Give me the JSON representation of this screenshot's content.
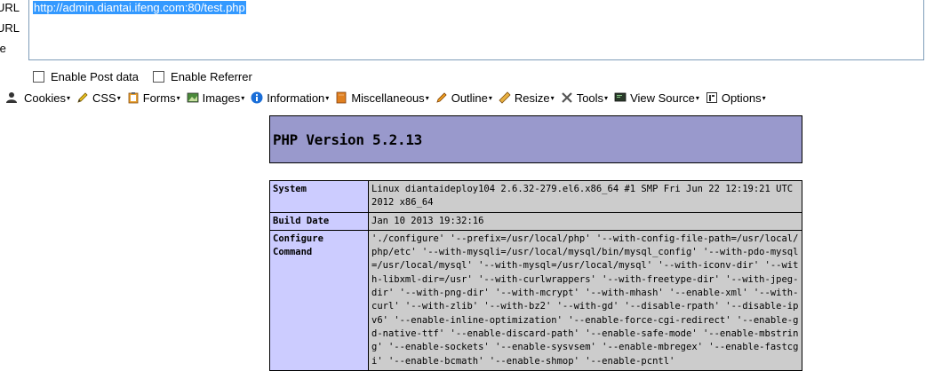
{
  "side_labels": [
    "URL",
    "URL",
    "te"
  ],
  "url": "http://admin.diantai.ifeng.com:80/test.php",
  "options": [
    {
      "label": "Enable Post data",
      "checked": false
    },
    {
      "label": "Enable Referrer",
      "checked": false
    }
  ],
  "toolbar": [
    {
      "label": "",
      "icon": "user-icon"
    },
    {
      "label": "Cookies",
      "icon": "cookie-icon"
    },
    {
      "label": "CSS",
      "icon": "pencil-icon"
    },
    {
      "label": "Forms",
      "icon": "clipboard-icon"
    },
    {
      "label": "Images",
      "icon": "image-icon"
    },
    {
      "label": "Information",
      "icon": "info-icon"
    },
    {
      "label": "Miscellaneous",
      "icon": "book-icon"
    },
    {
      "label": "Outline",
      "icon": "pen-icon"
    },
    {
      "label": "Resize",
      "icon": "ruler-icon"
    },
    {
      "label": "Tools",
      "icon": "tools-icon"
    },
    {
      "label": "View Source",
      "icon": "monitor-icon"
    },
    {
      "label": "Options",
      "icon": "options-icon"
    }
  ],
  "php": {
    "title": "PHP Version 5.2.13",
    "rows": [
      {
        "key": "System",
        "value": "Linux diantaideploy104 2.6.32-279.el6.x86_64 #1 SMP Fri Jun 22 12:19:21 UTC 2012 x86_64"
      },
      {
        "key": "Build Date",
        "value": "Jan 10 2013 19:32:16"
      },
      {
        "key": "Configure Command",
        "value": "'./configure' '--prefix=/usr/local/php' '--with-config-file-path=/usr/local/php/etc' '--with-mysqli=/usr/local/mysql/bin/mysql_config' '--with-pdo-mysql=/usr/local/mysql' '--with-mysql=/usr/local/mysql' '--with-iconv-dir' '--with-libxml-dir=/usr' '--with-curlwrappers' '--with-freetype-dir' '--with-jpeg-dir' '--with-png-dir' '--with-mcrypt' '--with-mhash' '--enable-xml' '--with-curl' '--with-zlib' '--with-bz2' '--with-gd' '--disable-rpath' '--disable-ipv6' '--enable-inline-optimization' '--enable-force-cgi-redirect' '--enable-gd-native-ttf' '--enable-discard-path' '--enable-safe-mode' '--enable-mbstring' '--enable-sockets' '--enable-sysvsem' '--enable-mbregex' '--enable-fastcgi' '--enable-bcmath' '--enable-shmop' '--enable-pcntl'"
      }
    ]
  },
  "colors": {
    "header_bg": "#9999cc",
    "key_bg": "#ccccff",
    "value_bg": "#cccccc",
    "url_highlight": "#3399ff"
  }
}
